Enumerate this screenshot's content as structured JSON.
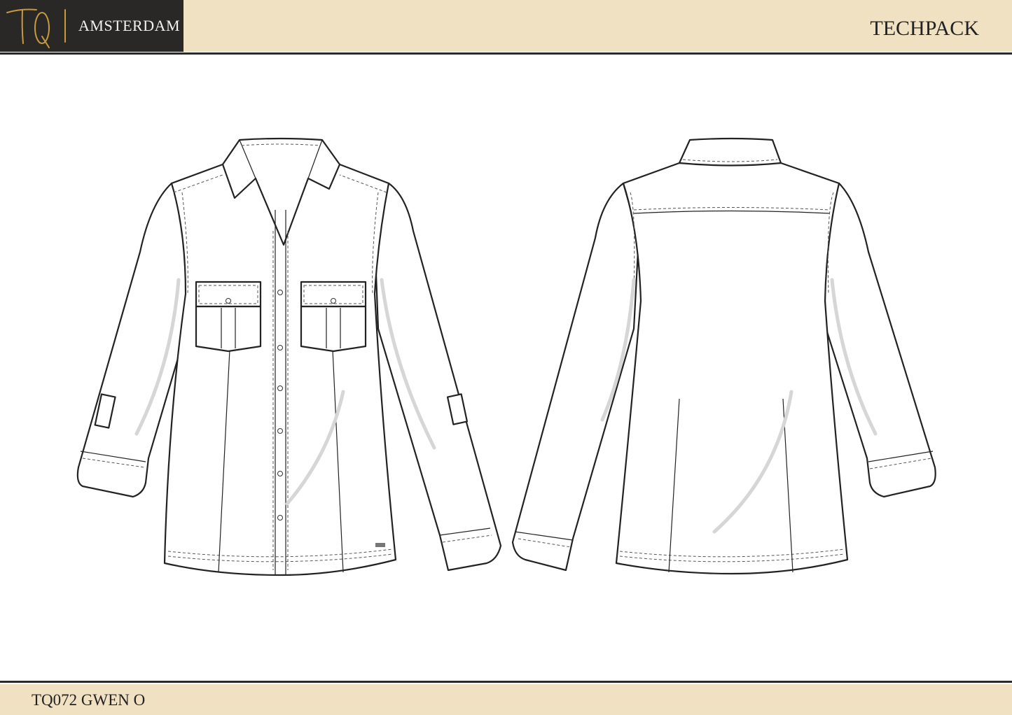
{
  "header": {
    "logo_text": "TQ",
    "brand": "AMSTERDAM",
    "title": "TECHPACK"
  },
  "footer": {
    "style_code": "TQ072 GWEN O"
  },
  "colors": {
    "band": "#f0e1c2",
    "logo_bg": "#2a2826",
    "logo_gold": "#c89a3c"
  },
  "drawings": [
    "shirt-front-flat-sketch",
    "shirt-back-flat-sketch"
  ]
}
